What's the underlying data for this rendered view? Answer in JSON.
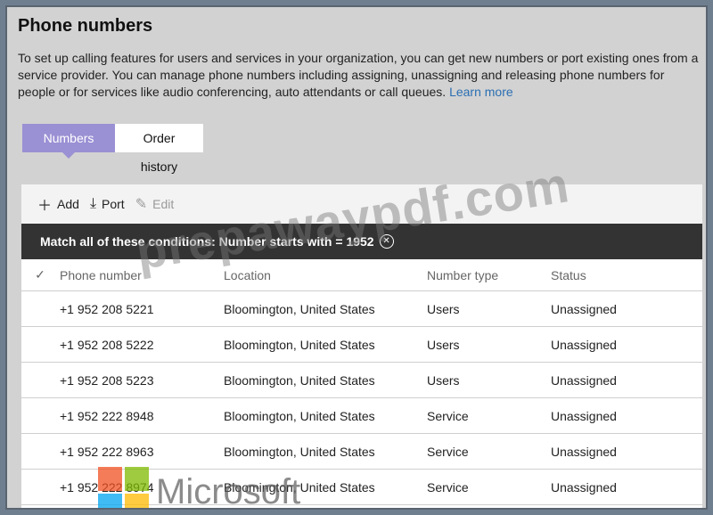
{
  "header": {
    "title": "Phone numbers",
    "description": "To set up calling features for users and services in your organization, you can get new numbers or port existing ones from a service provider. You can manage phone numbers including assigning, unassigning and releasing phone numbers for people or for services like audio conferencing, auto attendants or call queues.",
    "learn_more": "Learn more"
  },
  "tabs": [
    {
      "label": "Numbers",
      "active": true
    },
    {
      "label": "Order history",
      "active": false
    }
  ],
  "toolbar": {
    "add_label": "Add",
    "port_label": "Port",
    "edit_label": "Edit"
  },
  "filter": {
    "text": "Match all of these conditions: Number starts with = 1952"
  },
  "table": {
    "columns": [
      "Phone number",
      "Location",
      "Number type",
      "Status"
    ],
    "rows": [
      {
        "phone": "+1 952 208 5221",
        "location": "Bloomington, United States",
        "type": "Users",
        "status": "Unassigned"
      },
      {
        "phone": "+1 952 208 5222",
        "location": "Bloomington, United States",
        "type": "Users",
        "status": "Unassigned"
      },
      {
        "phone": "+1 952 208 5223",
        "location": "Bloomington, United States",
        "type": "Users",
        "status": "Unassigned"
      },
      {
        "phone": "+1 952 222 8948",
        "location": "Bloomington, United States",
        "type": "Service",
        "status": "Unassigned"
      },
      {
        "phone": "+1 952 222 8963",
        "location": "Bloomington, United States",
        "type": "Service",
        "status": "Unassigned"
      },
      {
        "phone": "+1 952 222 8974",
        "location": "Bloomington, United States",
        "type": "Service",
        "status": "Unassigned"
      }
    ]
  },
  "watermark": {
    "text": "prepawaypdf.com",
    "logo_text": "Microsoft",
    "logo_colors": [
      "#f25022",
      "#7fba00",
      "#00a4ef",
      "#ffb900"
    ]
  },
  "colors": {
    "active_tab": "#9a90d4",
    "filter_bar": "#333333",
    "link": "#2b6fb3"
  }
}
